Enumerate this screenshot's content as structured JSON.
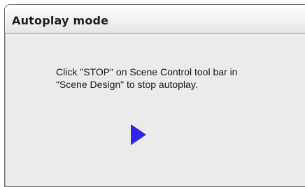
{
  "dialog": {
    "title": "Autoplay mode",
    "message": "Click \"STOP\" on Scene Control tool bar in \"Scene Design\" to stop autoplay.",
    "play_icon_color": "#2c25f0"
  }
}
